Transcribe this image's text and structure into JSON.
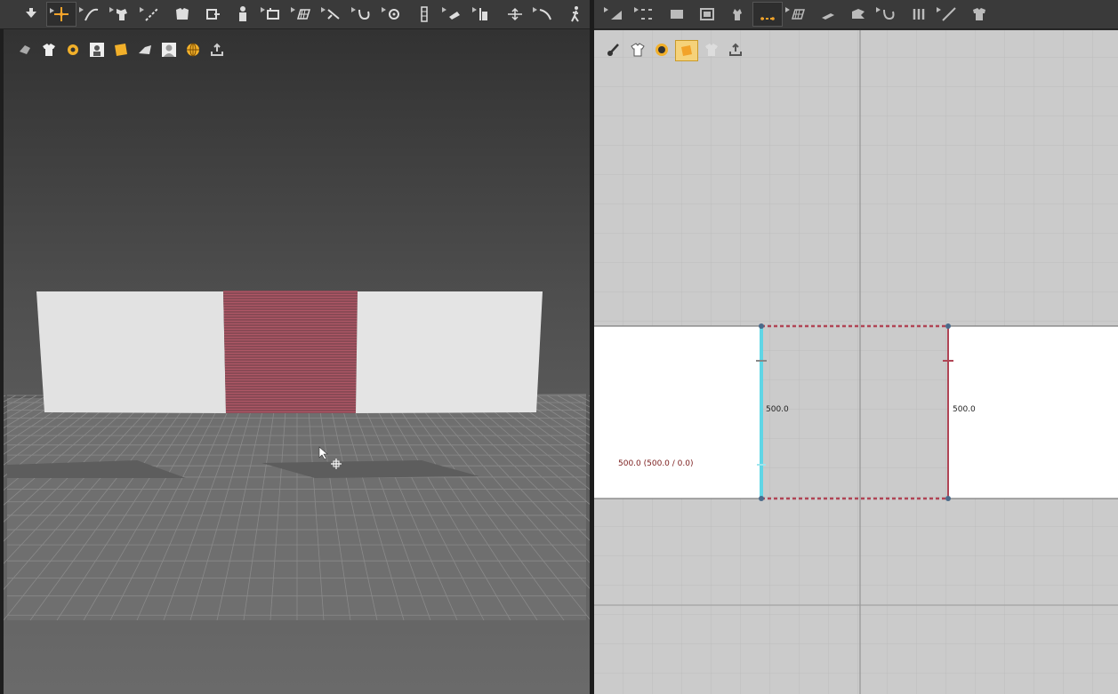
{
  "left_toolbar": {
    "icons": [
      "select-icon",
      "transform-pattern-icon",
      "edit-curvature-icon",
      "edit-pattern-icon",
      "segment-sewing-icon",
      "free-sewing-icon",
      "fold-arrangement-icon",
      "avatar-arrangement-icon",
      "pin-icon",
      "texture-icon",
      "tack-icon",
      "measure-icon",
      "fabric-icon",
      "puckering-icon",
      "strengthen-icon",
      "stretch-icon",
      "pose-icon"
    ]
  },
  "right_toolbar": {
    "icons": [
      "polygon-icon",
      "internal-polygon-icon",
      "rectangle-icon",
      "ellipse-icon",
      "dart-icon",
      "segment-length-icon",
      "grid-pattern-icon",
      "fold-icon",
      "trim-icon",
      "notch-icon",
      "pleats-icon",
      "seam-allowance-icon",
      "garment-icon"
    ]
  },
  "view3d": {
    "sub_toolbar": [
      "wireframe-icon",
      "garment-display-icon",
      "fabric-display-icon",
      "avatar-display-icon",
      "fabric-texture-icon",
      "render-icon",
      "avatar-silhouette-icon",
      "world-icon",
      "export-icon"
    ]
  },
  "view2d": {
    "sub_toolbar": [
      "brush-icon",
      "shirt-icon",
      "info-icon",
      "fabric-swatch-icon",
      "garment-hidden-icon",
      "export-icon"
    ],
    "labels": {
      "left_seam_length": "500.0",
      "right_seam_length": "500.0",
      "edge_measure": "500.0 (500.0 / 0.0)"
    }
  },
  "colors": {
    "selected_seam": "#5fd6e6",
    "seam_red": "#b04555",
    "pattern_white": "#ffffff",
    "selected_fabric": "#8b4a55"
  }
}
